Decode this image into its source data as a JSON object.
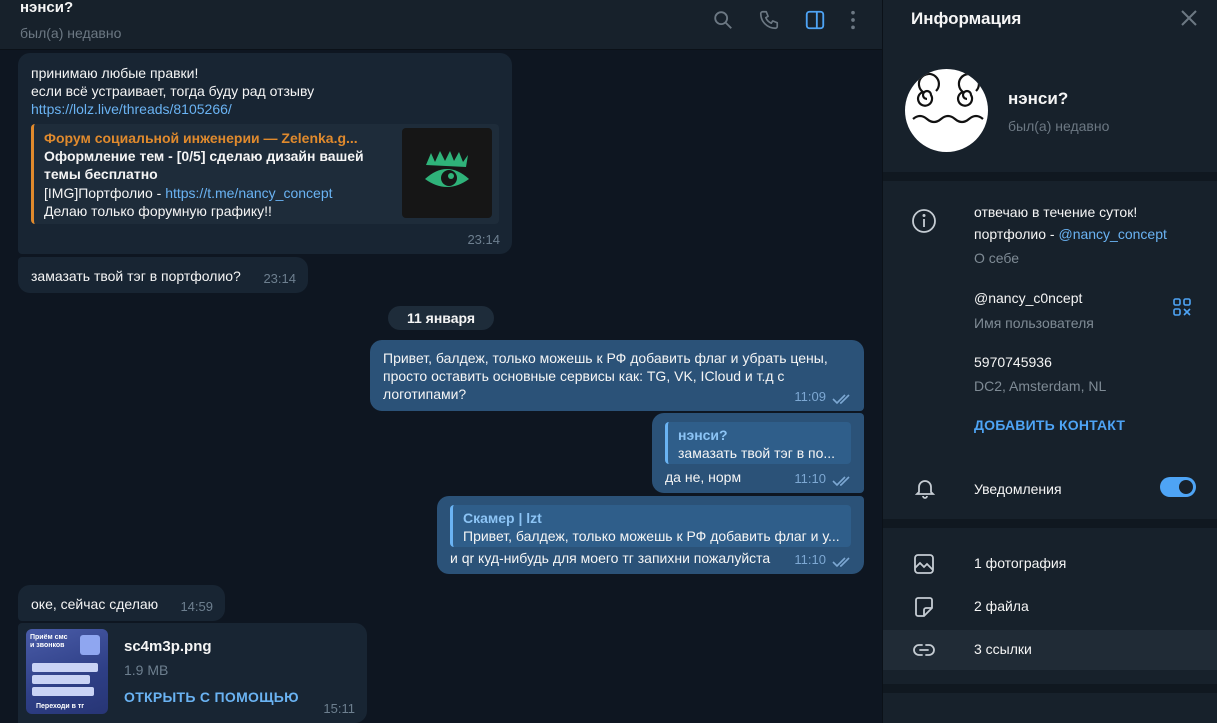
{
  "chat": {
    "title": "нэнси?",
    "status": "был(а) недавно"
  },
  "messages": {
    "m1": {
      "line1": "принимаю любые правки!",
      "line2": "если всё устраивает, тогда буду рад отзыву",
      "link": "https://lolz.live/threads/8105266/",
      "preview": {
        "site": "Форум социальной инженерии — Zelenka.g...",
        "title": "Оформление тем - [0/5] сделаю дизайн вашей темы бесплатно",
        "desc_prefix": "[IMG]Портфолио - ",
        "desc_link": "https://t.me/nancy_concept",
        "desc2": "Делаю только форумную графику!!"
      },
      "time": "23:14"
    },
    "m2": {
      "text": "замазать твой тэг в портфолио?",
      "time": "23:14"
    },
    "date_separator": "11 января",
    "m3": {
      "text": "Привет, балдеж, только можешь к РФ добавить флаг и убрать цены, просто оставить основные сервисы как: TG, VK, ICloud и т.д с логотипами?",
      "time": "11:09"
    },
    "m4": {
      "reply_name": "нэнси?",
      "reply_text": "замазать твой тэг в по...",
      "text": "да не, норм",
      "time": "11:10"
    },
    "m5": {
      "reply_name": "Скамер | lzt",
      "reply_text": "Привет, балдеж, только можешь к РФ добавить флаг и у...",
      "text": "и qr куд-нибудь для моего тг запихни пожалуйста",
      "time": "11:10"
    },
    "m6": {
      "text": "оке, сейчас сделаю",
      "time": "14:59"
    },
    "m7": {
      "file_name": "sc4m3p.png",
      "file_size": "1.9 MB",
      "open_with": "ОТКРЫТЬ С ПОМОЩЬЮ",
      "time": "15:11",
      "thumb_lines": [
        "Приём смс",
        "и звонков",
        "Переходи в тг"
      ]
    }
  },
  "info": {
    "title": "Информация",
    "name": "нэнси?",
    "status": "был(а) недавно",
    "bio_line1": "отвечаю в течение суток!",
    "bio_prefix": "портфолио - ",
    "bio_link": "@nancy_concept",
    "bio_label": "О себе",
    "username": "@nancy_c0ncept",
    "username_label": "Имя пользователя",
    "id": "5970745936",
    "dc": "DC2, Amsterdam, NL",
    "add_contact": "ДОБАВИТЬ КОНТАКТ",
    "notifications": "Уведомления",
    "notifications_on": true,
    "media": [
      {
        "label": "1 фотография",
        "icon": "photo-icon"
      },
      {
        "label": "2 файла",
        "icon": "file-icon"
      },
      {
        "label": "3 ссылки",
        "icon": "link-icon"
      }
    ]
  },
  "colors": {
    "bg": "#0e1621",
    "panel": "#17212b",
    "incoming": "#182533",
    "outgoing": "#2b5278",
    "accent": "#6ab3f3",
    "preview_accent": "#e08a2d"
  }
}
